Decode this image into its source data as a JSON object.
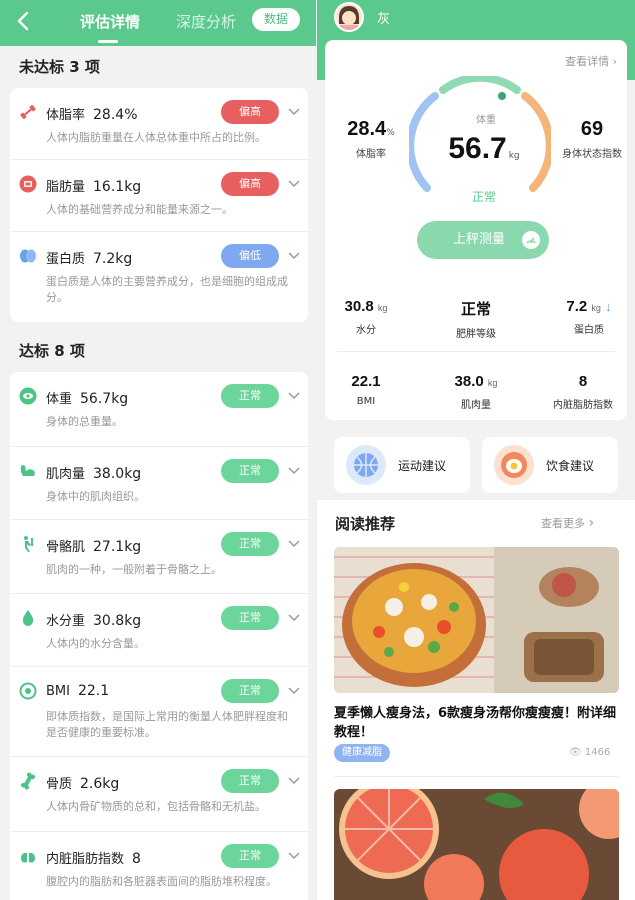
{
  "left": {
    "tabs": {
      "evaluation": "评估详情",
      "deep_analysis": "深度分析",
      "data_button": "数据"
    },
    "unmet": {
      "title": "未达标 3 项",
      "items": [
        {
          "name": "体脂率",
          "value": "28.4%",
          "status": "偏高",
          "desc": "人体内脂肪重量在人体总体重中所占的比例。",
          "icon": "dumbbell-icon"
        },
        {
          "name": "脂肪量",
          "value": "16.1kg",
          "status": "偏高",
          "desc": "人体的基础营养成分和能量来源之一。",
          "icon": "fat-icon"
        },
        {
          "name": "蛋白质",
          "value": "7.2kg",
          "status": "偏低",
          "desc": "蛋白质是人体的主要营养成分，也是细胞的组成成分。",
          "icon": "protein-icon"
        }
      ]
    },
    "met": {
      "title": "达标 8 项",
      "items": [
        {
          "name": "体重",
          "value": "56.7kg",
          "status": "正常",
          "desc": "身体的总重量。",
          "icon": "weight-icon"
        },
        {
          "name": "肌肉量",
          "value": "38.0kg",
          "status": "正常",
          "desc": "身体中的肌肉组织。",
          "icon": "muscle-icon"
        },
        {
          "name": "骨骼肌",
          "value": "27.1kg",
          "status": "正常",
          "desc": "肌肉的一种，一般附着于骨骼之上。",
          "icon": "skeletal-muscle-icon"
        },
        {
          "name": "水分重",
          "value": "30.8kg",
          "status": "正常",
          "desc": "人体内的水分含量。",
          "icon": "water-drop-icon"
        },
        {
          "name": "BMI",
          "value": "22.1",
          "status": "正常",
          "desc": "即体质指数，是国际上常用的衡量人体肥胖程度和是否健康的重要标准。",
          "icon": "bmi-icon"
        },
        {
          "name": "骨质",
          "value": "2.6kg",
          "status": "正常",
          "desc": "人体内骨矿物质的总和，包括骨骼和无机盐。",
          "icon": "bone-icon"
        },
        {
          "name": "内脏脂肪指数",
          "value": "8",
          "status": "正常",
          "desc": "腹腔内的脂肪和各脏器表面间的脂肪堆积程度。",
          "icon": "visceral-fat-icon"
        }
      ]
    }
  },
  "right": {
    "user_name": "灰",
    "detail_link": "查看详情",
    "fat_rate": {
      "value": "28.4",
      "unit": "%",
      "label": "体脂率"
    },
    "weight": {
      "title": "体重",
      "value": "56.7",
      "unit": "kg",
      "status": "正常"
    },
    "body_index": {
      "value": "69",
      "label": "身体状态指数"
    },
    "weigh_button": "上秤测量",
    "metrics": [
      {
        "value": "30.8",
        "unit": "kg",
        "label": "水分"
      },
      {
        "value": "正常",
        "unit": "",
        "label": "肥胖等级"
      },
      {
        "value": "7.2",
        "unit": "kg",
        "label": "蛋白质"
      },
      {
        "value": "22.1",
        "unit": "",
        "label": "BMI"
      },
      {
        "value": "38.0",
        "unit": "kg",
        "label": "肌肉量"
      },
      {
        "value": "8",
        "unit": "",
        "label": "内脏脂肪指数"
      }
    ],
    "advice": {
      "exercise": "运动建议",
      "diet": "饮食建议"
    },
    "reading": {
      "title": "阅读推荐",
      "more": "查看更多",
      "article1": {
        "title": "夏季懒人瘦身法，6款瘦身汤帮你瘦瘦瘦！附详细教程！",
        "tag": "健康减脂",
        "views": "1466"
      }
    },
    "colors": {
      "accent": "#5bc98e",
      "high": "#e85f5f",
      "low": "#7fa8f0",
      "normal": "#6cd59b"
    }
  }
}
